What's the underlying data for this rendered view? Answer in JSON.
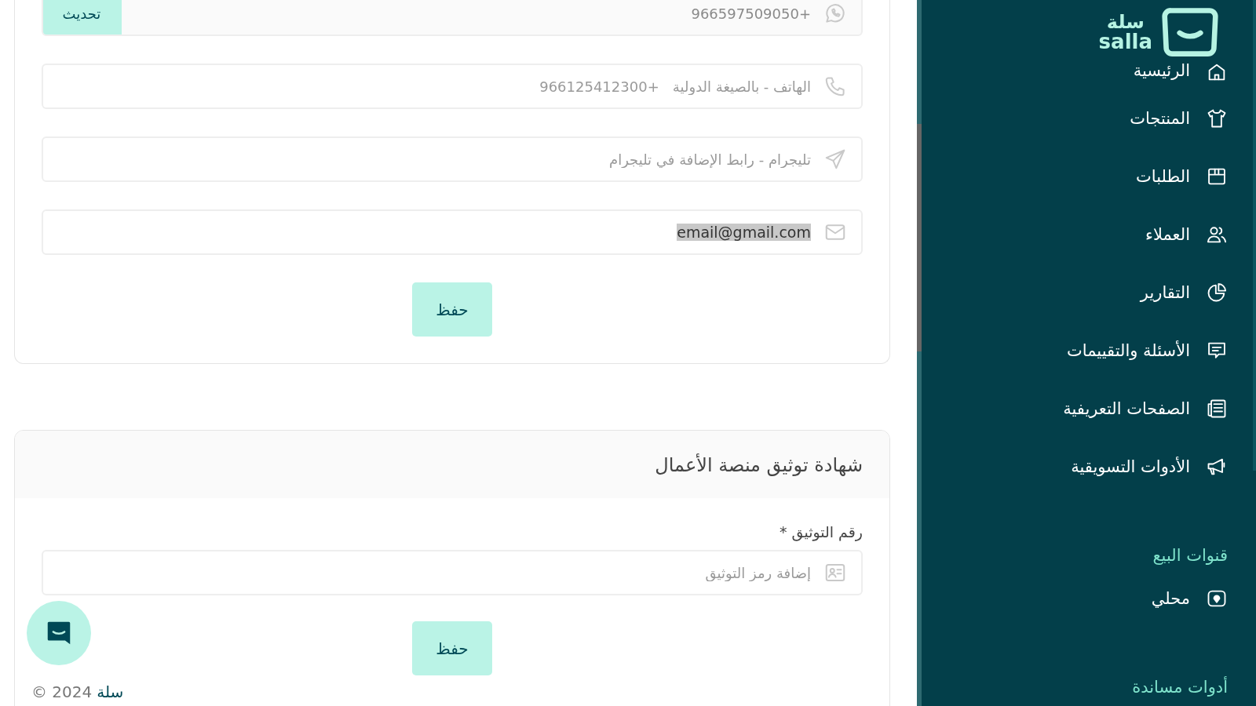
{
  "contact_card": {
    "fields": [
      {
        "value": "+966597509050",
        "disabled": true,
        "action": "تحديث"
      },
      {
        "placeholder": "الهاتف - بالصيغة الدولية   +966125412300"
      },
      {
        "placeholder": "تليجرام - رابط الإضافة في تليجرام"
      },
      {
        "value": "email@gmail.com",
        "highlighted": true
      }
    ],
    "save_button": "حفظ"
  },
  "verification_card": {
    "title": "شهادة توثيق منصة الأعمال",
    "label": "رقم التوثيق *",
    "field": {
      "placeholder": "إضافة رمز التوثيق"
    },
    "save_button": "حفظ"
  },
  "footer": {
    "brand": "سلة",
    "copyright": "© 2024"
  },
  "sidebar": {
    "logo_arabic": "سلة",
    "logo_latin": "salla",
    "items": [
      {
        "kind": "item",
        "label": "الرئيسية"
      },
      {
        "kind": "item",
        "label": "المنتجات"
      },
      {
        "kind": "item",
        "label": "الطلبات"
      },
      {
        "kind": "item",
        "label": "العملاء"
      },
      {
        "kind": "item",
        "label": "التقارير"
      },
      {
        "kind": "item",
        "label": "الأسئلة والتقييمات"
      },
      {
        "kind": "item",
        "label": "الصفحات التعريفية"
      },
      {
        "kind": "item",
        "label": "الأدوات التسويقية"
      },
      {
        "kind": "heading",
        "label": "قنوات البيع"
      },
      {
        "kind": "item",
        "label": "محلي"
      },
      {
        "kind": "heading",
        "label": "أدوات مساندة"
      }
    ]
  }
}
